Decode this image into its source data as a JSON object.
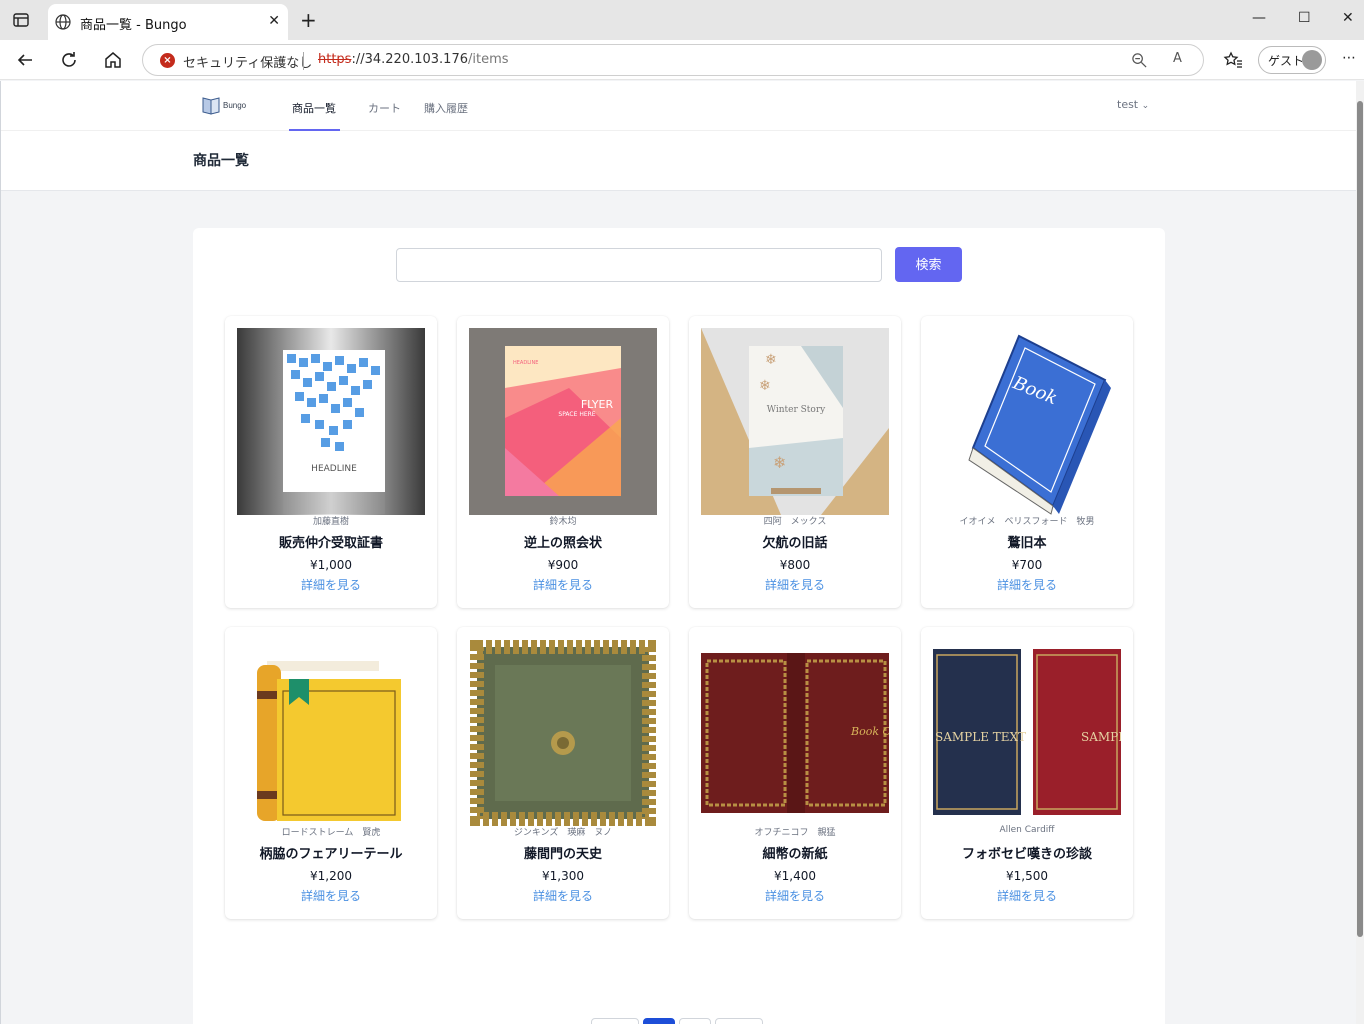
{
  "browser": {
    "tab_title": "商品一覧 - Bungo",
    "security_label": "セキュリティ保護なし",
    "url_scheme": "https",
    "url_host": "://34.220.103.176",
    "url_path": "/items",
    "guest_label": "ゲスト"
  },
  "nav": {
    "brand": "Bungo",
    "links": [
      "商品一覧",
      "カート",
      "購入履歴"
    ],
    "user": "test"
  },
  "page": {
    "title": "商品一覧"
  },
  "search": {
    "placeholder": "",
    "button_label": "検索"
  },
  "products": [
    {
      "author": "加藤直樹",
      "name": "販売仲介受取証書",
      "price": "¥1,000",
      "link": "詳細を見る"
    },
    {
      "author": "鈴木均",
      "name": "逆上の照会状",
      "price": "¥900",
      "link": "詳細を見る"
    },
    {
      "author": "四阿　メックス",
      "name": "欠航の旧話",
      "price": "¥800",
      "link": "詳細を見る"
    },
    {
      "author": "イオイメ　ベリスフォード　牧男",
      "name": "鶩旧本",
      "price": "¥700",
      "link": "詳細を見る"
    },
    {
      "author": "ロードストレーム　賢虎",
      "name": "柄脇のフェアリーテール",
      "price": "¥1,200",
      "link": "詳細を見る"
    },
    {
      "author": "ジンキンズ　瑛麻　ヌノ",
      "name": "藤間門の天史",
      "price": "¥1,300",
      "link": "詳細を見る"
    },
    {
      "author": "オフチニコフ　親猛",
      "name": "細幣の新紙",
      "price": "¥1,400",
      "link": "詳細を見る"
    },
    {
      "author": "Allen Cardiff",
      "name": "フォボセビ嘆きの珍談",
      "price": "¥1,500",
      "link": "詳細を見る"
    }
  ],
  "cover_text": {
    "c1": "HEADLINE",
    "c2_top": "HEADLINE",
    "c2_flyer": "FLYER",
    "c2_space": "SPACE HERE",
    "c3_title": "Winter Story",
    "c4_title": "Book",
    "c7_title": "Book C",
    "c8_left": "SAMPLE TEXT",
    "c8_right": "SAMPLE TEXT"
  },
  "colors": {
    "accent": "#6366f1",
    "link": "#4a90e2"
  }
}
